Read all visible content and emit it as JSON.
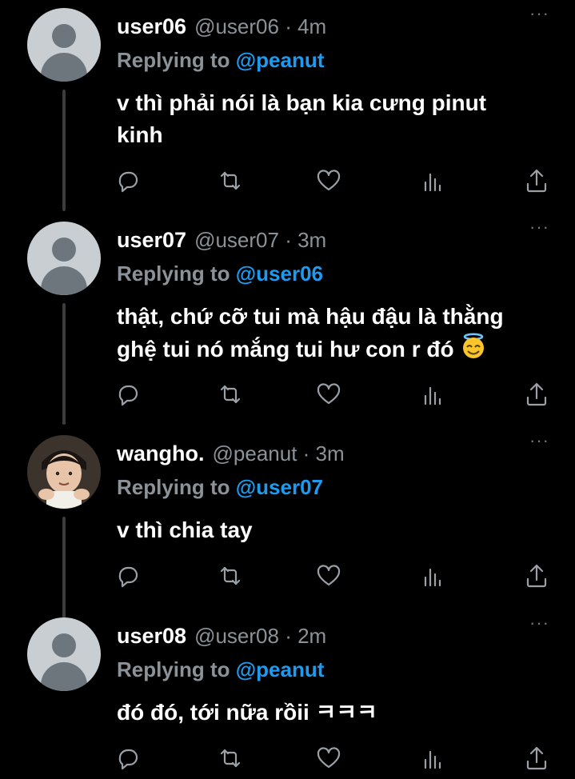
{
  "tweets": [
    {
      "name": "user06",
      "handle": "@user06 · 4m",
      "reply_prefix": "Replying to",
      "reply_to": "@peanut",
      "lines": [
        "v thì phải nói là bạn kia cưng pinut",
        "kinh"
      ],
      "avatar": "default-avatar"
    },
    {
      "name": "user07",
      "handle": "@user07 · 3m",
      "reply_prefix": "Replying to",
      "reply_to": "@user06",
      "lines": [
        "thật, chứ cỡ tui mà hậu đậu là thằng",
        "ghệ tui nó mắng tui hư con r đó"
      ],
      "emoji": "smiling-face-with-halo-emoji",
      "avatar": "default-avatar"
    },
    {
      "name": "wangho.",
      "handle": "@peanut · 3m",
      "reply_prefix": "Replying to",
      "reply_to": "@user07",
      "lines": [
        "v thì chia tay"
      ],
      "avatar": "photo-avatar"
    },
    {
      "name": "user08",
      "handle": "@user08 · 2m",
      "reply_prefix": "Replying to",
      "reply_to": "@peanut",
      "lines": [
        "đó đó, tới nữa rồii ㅋㅋㅋ"
      ],
      "avatar": "default-avatar"
    }
  ],
  "more_glyph": "···",
  "icons": [
    "reply-icon",
    "retweet-icon",
    "like-icon",
    "analytics-icon",
    "share-icon"
  ],
  "colors": {
    "background": "#000000",
    "mention": "#1d9bf0",
    "secondary": "#8b9298",
    "icon": "#9aa0a6"
  }
}
